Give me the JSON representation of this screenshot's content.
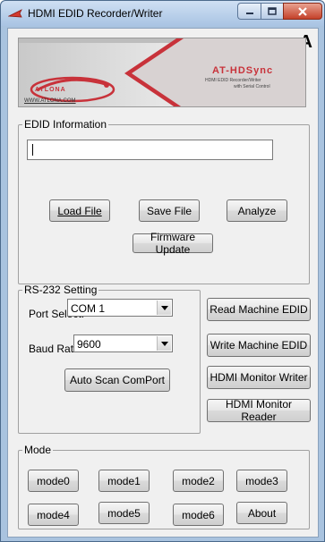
{
  "window": {
    "title": "HDMI EDID Recorder/Writer",
    "corner_letter": "A"
  },
  "banner": {
    "product": "AT-HDSync",
    "tagline_1": "HDMI EDID Recorder/Writer",
    "tagline_2": "with Serial Control",
    "brand": "ATLONA",
    "url": "WWW.ATLONA.COM"
  },
  "edid": {
    "group_label": "EDID Information",
    "text_value": "",
    "load_label": "Load File",
    "save_label": "Save File",
    "analyze_label": "Analyze",
    "firmware_label": "Firmware Update"
  },
  "rs232": {
    "group_label": "RS-232 Setting",
    "port_label": "Port Select:",
    "port_value": "COM 1",
    "baud_label": "Baud Rate:",
    "baud_value": "9600",
    "scan_label": "Auto Scan ComPort"
  },
  "actions": {
    "read_label": "Read Machine EDID",
    "write_label": "Write Machine EDID",
    "monitor_writer_label": "HDMI Monitor Writer",
    "monitor_reader_label": "HDMI Monitor Reader"
  },
  "mode": {
    "group_label": "Mode",
    "buttons": [
      "mode0",
      "mode1",
      "mode2",
      "mode3",
      "mode4",
      "mode5",
      "mode6",
      "About"
    ]
  },
  "colors": {
    "accent_red": "#c8323a",
    "banner_grey": "#d6d6d6",
    "title_blue": "#a9c4e3"
  }
}
